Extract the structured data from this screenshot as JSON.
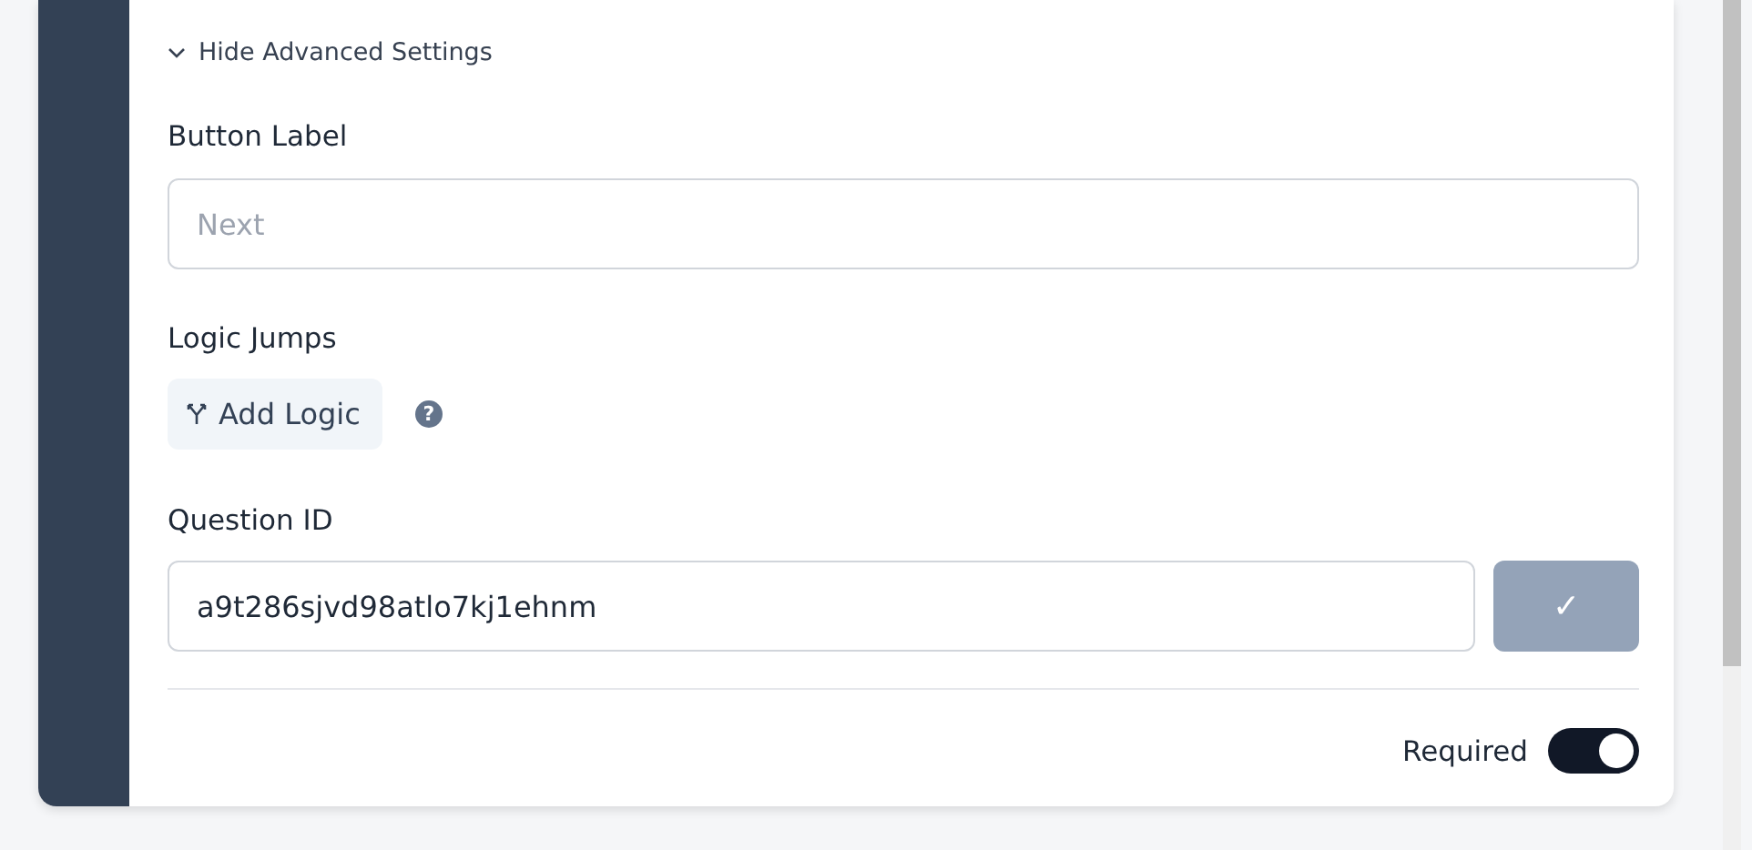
{
  "advanced_toggle": {
    "label": "Hide Advanced Settings",
    "expanded": true
  },
  "button_label": {
    "label": "Button Label",
    "placeholder": "Next"
  },
  "logic_jumps": {
    "label": "Logic Jumps",
    "button": "Add Logic",
    "help": "?"
  },
  "question_id": {
    "label": "Question ID",
    "value": "a9t286sjvd98atlo7kj1ehnm",
    "confirm": "✓",
    "confirm_disabled": true
  },
  "required": {
    "label": "Required",
    "on": true
  }
}
